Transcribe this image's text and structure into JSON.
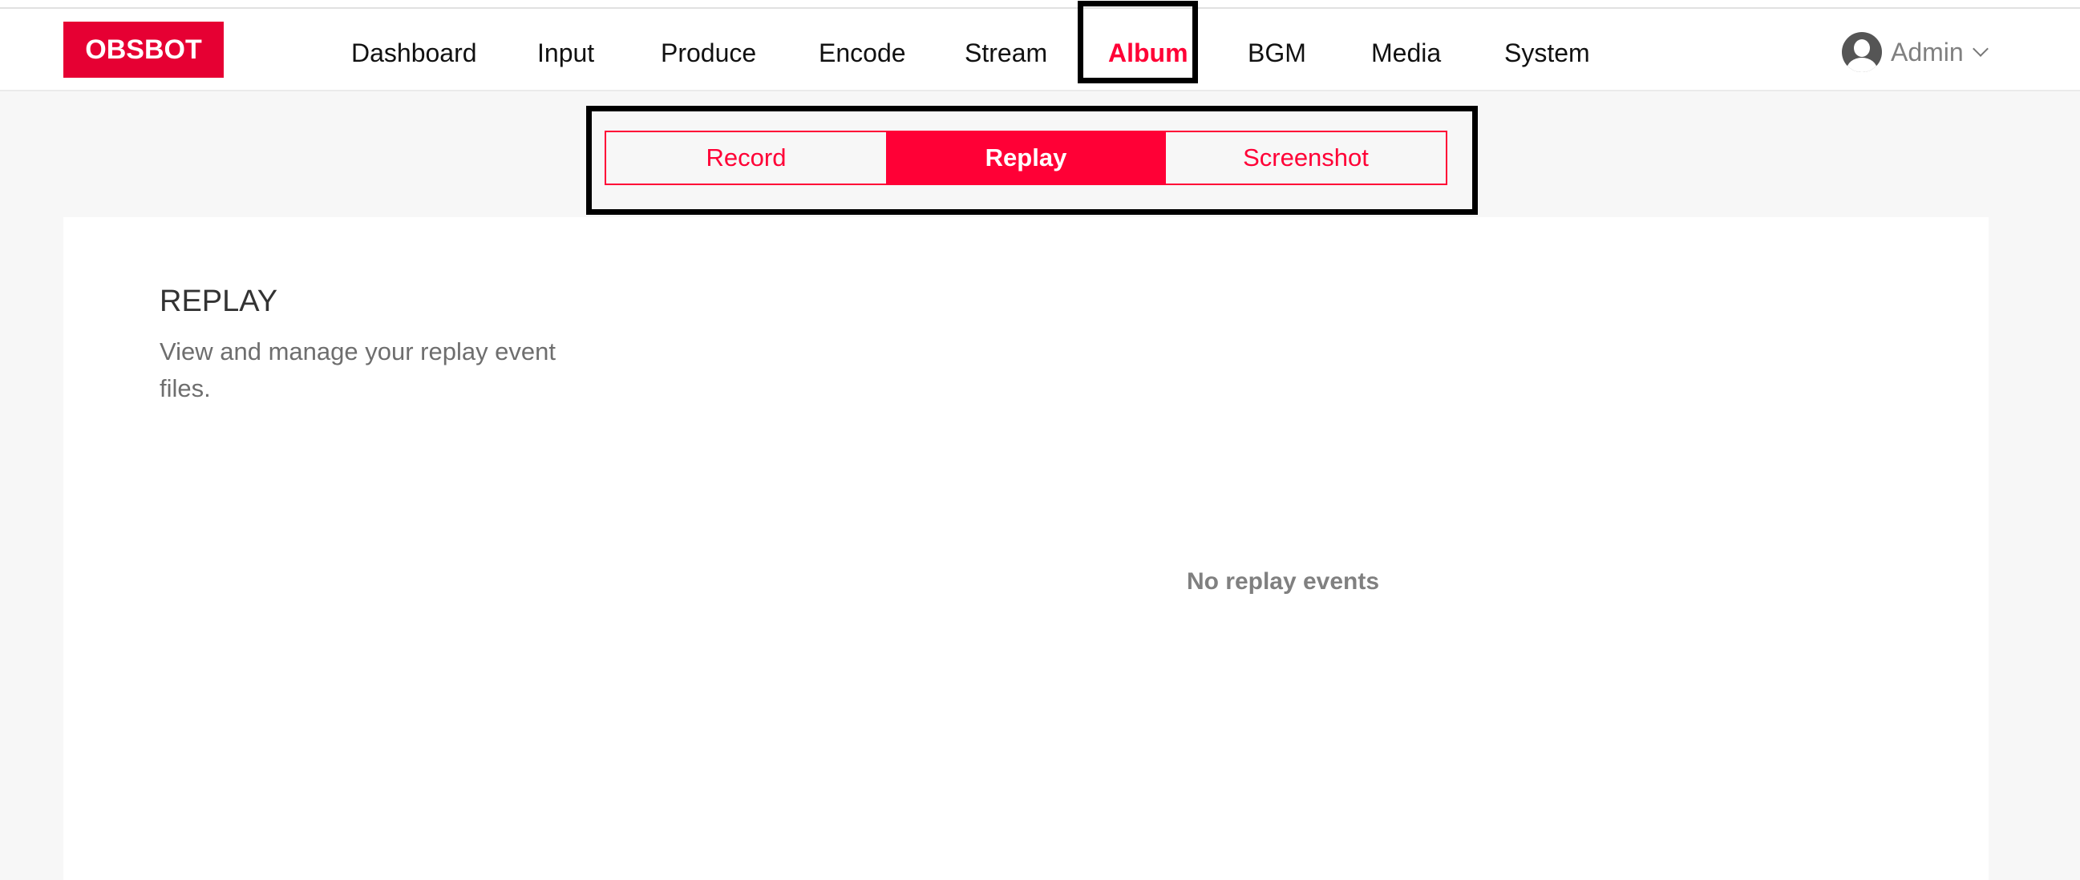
{
  "header": {
    "logo_text": "OBSBOT",
    "nav": [
      {
        "label": "Dashboard",
        "active": false
      },
      {
        "label": "Input",
        "active": false
      },
      {
        "label": "Produce",
        "active": false
      },
      {
        "label": "Encode",
        "active": false
      },
      {
        "label": "Stream",
        "active": false
      },
      {
        "label": "Album",
        "active": true
      },
      {
        "label": "BGM",
        "active": false
      },
      {
        "label": "Media",
        "active": false
      },
      {
        "label": "System",
        "active": false
      }
    ],
    "user": {
      "name": "Admin",
      "avatar_icon": "user-avatar-icon",
      "dropdown_icon": "chevron-down-icon"
    }
  },
  "subtabs": [
    {
      "label": "Record",
      "active": false
    },
    {
      "label": "Replay",
      "active": true
    },
    {
      "label": "Screenshot",
      "active": false
    }
  ],
  "content": {
    "title": "REPLAY",
    "description": "View and manage your replay event files.",
    "empty_message": "No replay events"
  },
  "colors": {
    "brand": "#e60033",
    "accent": "#ff0036",
    "page_bg": "#f7f7f7"
  }
}
